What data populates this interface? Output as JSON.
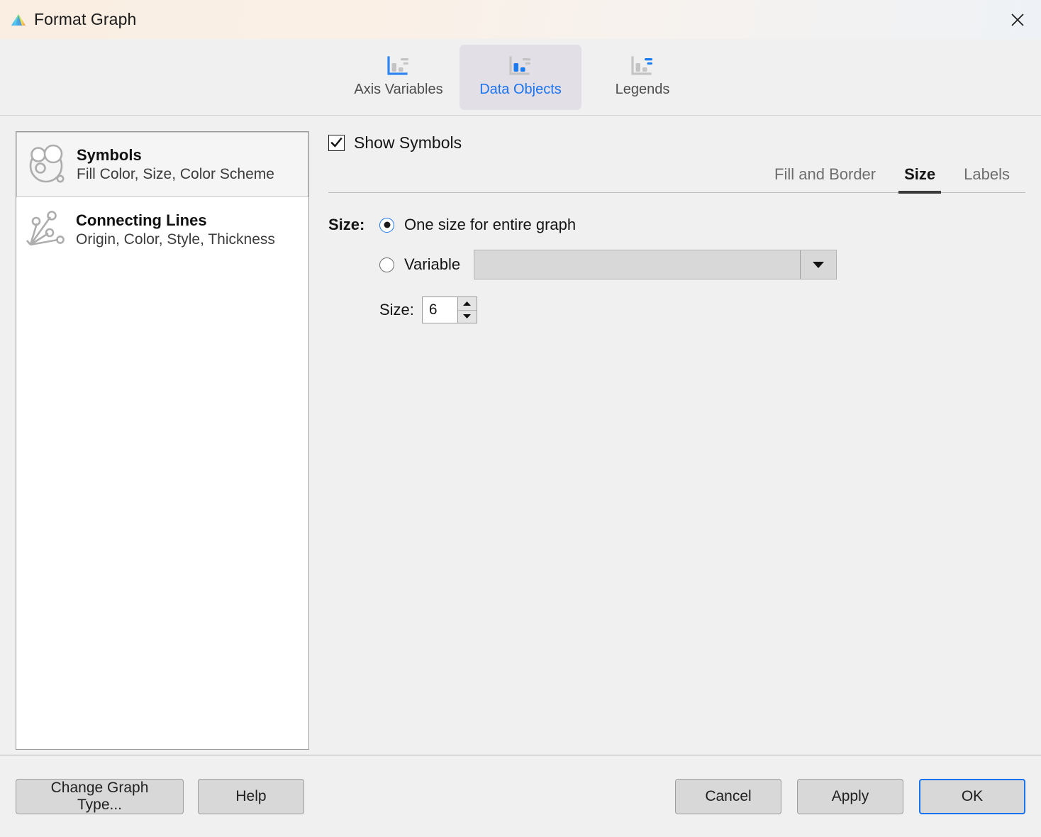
{
  "window": {
    "title": "Format Graph",
    "app_icon": "graphpad-prism-triangle-icon",
    "close_icon": "close-icon",
    "titlebar_gradient_start": "#faeee2",
    "titlebar_gradient_end": "#eef2f6"
  },
  "top_tabs": {
    "active": "Data Objects",
    "accent_color": "#1a73f0",
    "items": [
      {
        "label": "Axis Variables",
        "icon": "axis-variables-chart-icon",
        "active": false
      },
      {
        "label": "Data Objects",
        "icon": "data-objects-chart-icon",
        "active": true
      },
      {
        "label": "Legends",
        "icon": "legends-chart-icon",
        "active": false
      }
    ]
  },
  "sidebar": {
    "items": [
      {
        "title": "Symbols",
        "subtitle": "Fill Color, Size, Color Scheme",
        "icon": "symbols-circles-icon",
        "selected": true
      },
      {
        "title": "Connecting Lines",
        "subtitle": "Origin, Color, Style, Thickness",
        "icon": "connecting-lines-icon",
        "selected": false
      }
    ]
  },
  "main": {
    "show_symbols": {
      "label": "Show Symbols",
      "checked": true
    },
    "sub_tabs": {
      "active": "Size",
      "items": [
        {
          "label": "Fill and Border",
          "active": false
        },
        {
          "label": "Size",
          "active": true
        },
        {
          "label": "Labels",
          "active": false
        }
      ]
    },
    "size_section": {
      "group_label": "Size:",
      "radio_one_size": {
        "label": "One size for entire graph",
        "selected": true
      },
      "radio_variable": {
        "label": "Variable",
        "selected": false
      },
      "variable_combo": {
        "value": "",
        "placeholder": "",
        "arrow_icon": "chevron-down-icon"
      },
      "size_field": {
        "label": "Size:",
        "value": "6",
        "up_icon": "caret-up-icon",
        "down_icon": "caret-down-icon"
      }
    }
  },
  "footer": {
    "change_graph_type": "Change Graph Type...",
    "help": "Help",
    "cancel": "Cancel",
    "apply": "Apply",
    "ok": "OK"
  }
}
